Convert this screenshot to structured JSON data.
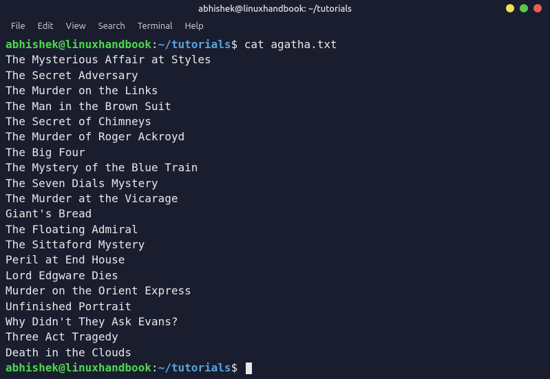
{
  "titlebar": {
    "title": "abhishek@linuxhandbook: ~/tutorials"
  },
  "menubar": {
    "items": [
      "File",
      "Edit",
      "View",
      "Search",
      "Terminal",
      "Help"
    ]
  },
  "terminal": {
    "prompt1": {
      "user_host": "abhishek@linuxhandbook",
      "colon": ":",
      "path": "~/tutorials",
      "dollar": "$ ",
      "command": "cat agatha.txt"
    },
    "output": [
      "The Mysterious Affair at Styles",
      "The Secret Adversary",
      "The Murder on the Links",
      "The Man in the Brown Suit",
      "The Secret of Chimneys",
      "The Murder of Roger Ackroyd",
      "The Big Four",
      "The Mystery of the Blue Train",
      "The Seven Dials Mystery",
      "The Murder at the Vicarage",
      "Giant's Bread",
      "The Floating Admiral",
      "The Sittaford Mystery",
      "Peril at End House",
      "Lord Edgware Dies",
      "Murder on the Orient Express",
      "Unfinished Portrait",
      "Why Didn't They Ask Evans?",
      "Three Act Tragedy",
      "Death in the Clouds"
    ],
    "prompt2": {
      "user_host": "abhishek@linuxhandbook",
      "colon": ":",
      "path": "~/tutorials",
      "dollar": "$ "
    }
  }
}
